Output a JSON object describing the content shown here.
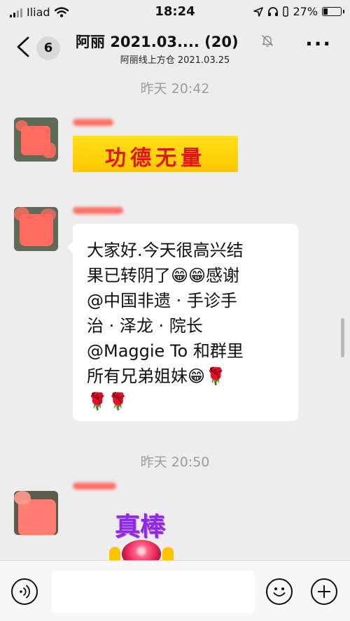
{
  "status_bar": {
    "carrier": "Iliad",
    "time": "18:24",
    "battery": "27%",
    "battery_level": 0.27
  },
  "header": {
    "back_count": "6",
    "title": "阿丽 2021.03.... (20)",
    "subtitle": "阿丽线上方仓 2021.03.25",
    "muted": true
  },
  "messages": {
    "timestamp_1": "昨天 20:42",
    "sticker_1_text": "功德无量",
    "bubble_text": "大家好.今天很高兴结\n果已转阴了😁😁感谢\n@中国非遗 · 手诊手\n治 · 泽龙 · 院长\n@Maggie To 和群里\n所有兄弟姐妹😁🌹\n🌹🌹",
    "timestamp_2": "昨天 20:50",
    "sticker_2_text": "真棒"
  },
  "input_bar": {
    "placeholder": ""
  },
  "colors": {
    "background": "#ededed",
    "bubble": "#ffffff",
    "redaction": "#ff6b5e",
    "sticker_yellow": "#ffd400",
    "sticker_red": "#e11414",
    "sticker_purple": "#8a2be2"
  }
}
